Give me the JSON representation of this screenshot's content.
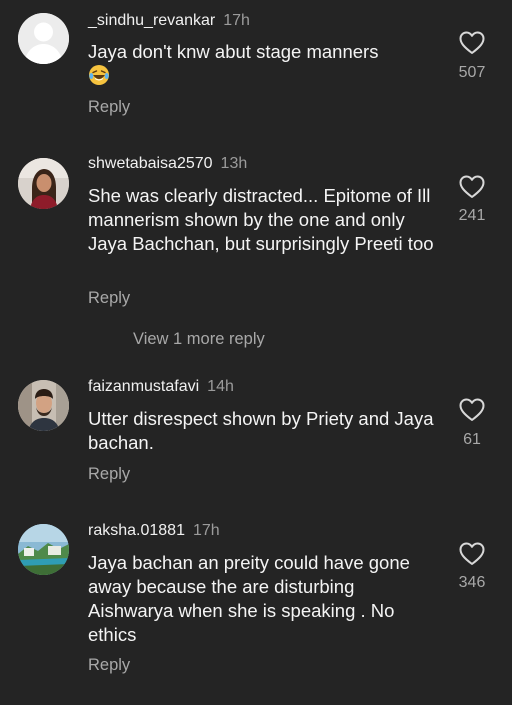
{
  "comments": [
    {
      "username": "_sindhu_revankar",
      "time": "17h",
      "text": "Jaya don't knw  abut  stage manners",
      "emoji": "laughing-with-tears",
      "likes": "507",
      "reply_label": "Reply"
    },
    {
      "username": "shwetabaisa2570",
      "time": "13h",
      "text": "She was clearly distracted... Epitome of Ill mannerism shown by the one and only Jaya Bachchan, but surprisingly Preeti too",
      "likes": "241",
      "reply_label": "Reply",
      "view_more": "View 1 more reply"
    },
    {
      "username": "faizanmustafavi",
      "time": "14h",
      "text": "Utter disrespect shown by Priety and Jaya bachan.",
      "likes": "61",
      "reply_label": "Reply"
    },
    {
      "username": "raksha.01881",
      "time": "17h",
      "text": "Jaya bachan an preity could have gone away because the are disturbing Aishwarya when she is speaking . No ethics",
      "likes": "346",
      "reply_label": "Reply"
    }
  ],
  "colors": {
    "background": "#242424",
    "text_primary": "#f4f4f4",
    "text_secondary": "#a8a8a8"
  },
  "icons": {
    "like": "heart-outline-icon"
  }
}
